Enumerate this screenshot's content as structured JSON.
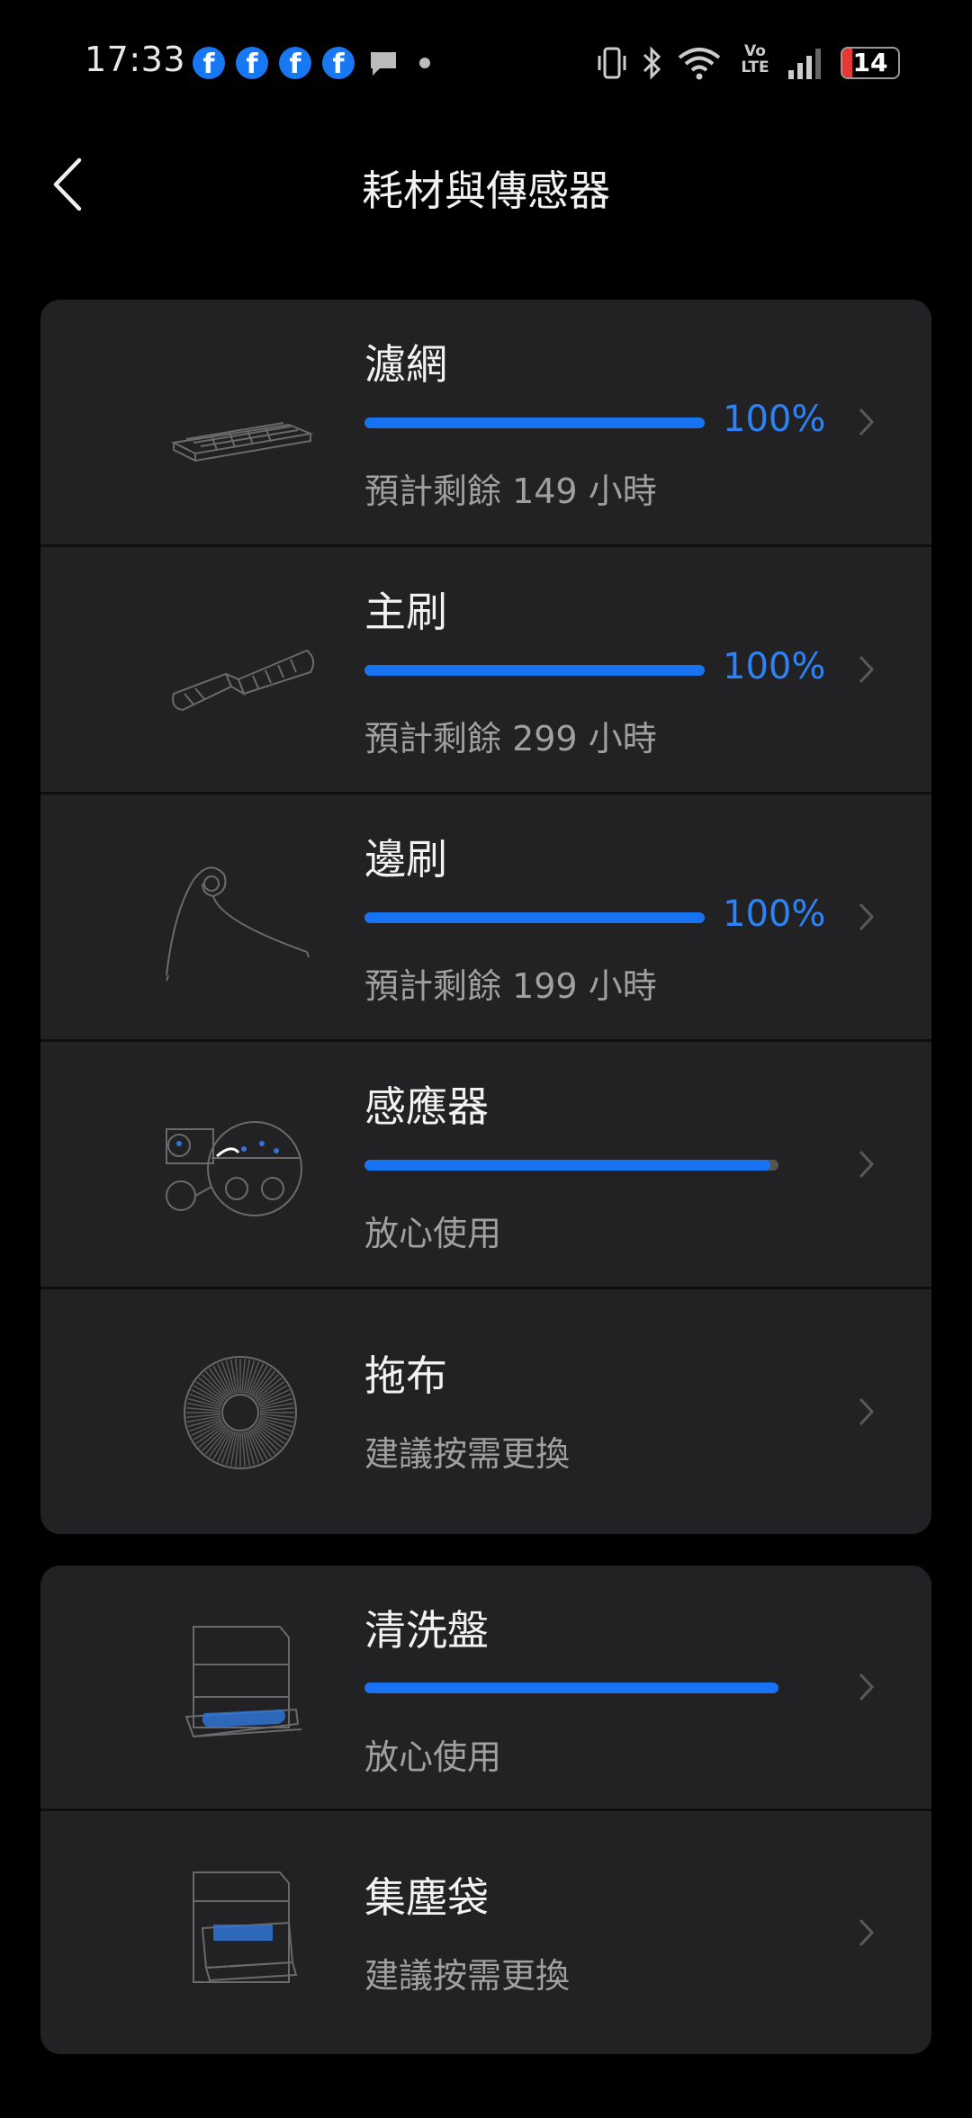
{
  "status_bar": {
    "time": "17:33",
    "notif_icons": [
      "facebook-icon",
      "facebook-icon",
      "facebook-icon",
      "facebook-icon",
      "chat-bubble-icon"
    ],
    "system_icons": [
      "vibrate-icon",
      "bluetooth-icon",
      "wifi-icon",
      "volte-icon",
      "signal-icon"
    ],
    "volte_top": "Vo",
    "volte_bottom": "LTE",
    "battery": "14"
  },
  "header": {
    "title": "耗材與傳感器"
  },
  "colors": {
    "accent": "#1773f1",
    "card_bg": "#222224",
    "page_bg": "#000000"
  },
  "groups": [
    {
      "items": [
        {
          "name": "濾網",
          "progress_pct": 100,
          "percent_text": "100%",
          "subtitle": "預計剩餘 149 小時",
          "icon": "filter-icon"
        },
        {
          "name": "主刷",
          "progress_pct": 100,
          "percent_text": "100%",
          "subtitle": "預計剩餘 299 小時",
          "icon": "main-brush-icon"
        },
        {
          "name": "邊刷",
          "progress_pct": 100,
          "percent_text": "100%",
          "subtitle": "預計剩餘 199 小時",
          "icon": "side-brush-icon"
        },
        {
          "name": "感應器",
          "progress_pct": 98,
          "subtitle": "放心使用",
          "icon": "sensor-icon"
        },
        {
          "name": "拖布",
          "subtitle": "建議按需更換",
          "icon": "mop-pad-icon"
        }
      ]
    },
    {
      "items": [
        {
          "name": "清洗盤",
          "progress_pct": 100,
          "subtitle": "放心使用",
          "icon": "wash-tray-icon"
        },
        {
          "name": "集塵袋",
          "subtitle": "建議按需更換",
          "icon": "dust-bag-icon"
        }
      ]
    }
  ]
}
